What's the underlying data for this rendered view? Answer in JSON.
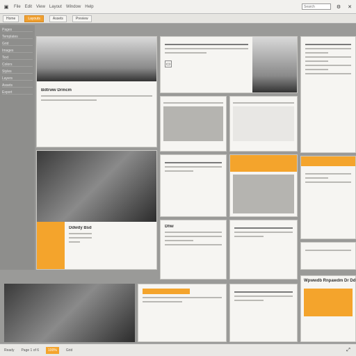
{
  "menubar": {
    "items": [
      "File",
      "Edit",
      "View",
      "Layout",
      "Window",
      "Help"
    ],
    "search_placeholder": "Search"
  },
  "tabs": [
    {
      "label": "Home"
    },
    {
      "label": "Layouts",
      "active": true
    },
    {
      "label": "Assets"
    },
    {
      "label": "Preview"
    }
  ],
  "sidebar": {
    "items": [
      "Pages",
      "Templates",
      "Grid",
      "Images",
      "Text",
      "Colors",
      "Styles",
      "Layers",
      "Assets",
      "Export"
    ]
  },
  "cards": {
    "c1_title": "Bdtrww Drmcm",
    "c2_title": "Ddwdy Bsd",
    "c3_title": "Dhw",
    "right_heading": "Wpwwdb Rnpawdm Dr Ddwdr"
  },
  "bottombar": {
    "items": [
      "Ready",
      "Page 1 of 6",
      "100%",
      "Grid"
    ]
  },
  "colors": {
    "accent": "#f4a42c",
    "panel": "#f6f5f2",
    "chrome": "#8e8e8c"
  }
}
